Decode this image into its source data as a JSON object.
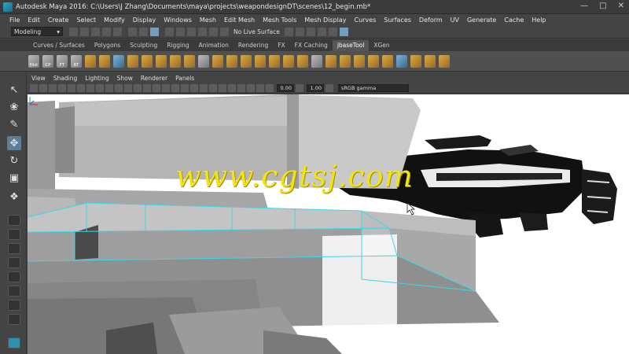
{
  "window": {
    "title": "Autodesk Maya 2016: C:\\Users\\J Zhang\\Documents\\maya\\projects\\weapondesignDT\\scenes\\12_begin.mb*",
    "controls": [
      "—",
      "□",
      "✕"
    ]
  },
  "menubar": [
    "File",
    "Edit",
    "Create",
    "Select",
    "Modify",
    "Display",
    "Windows",
    "Mesh",
    "Edit Mesh",
    "Mesh Tools",
    "Mesh Display",
    "Curves",
    "Surfaces",
    "Deform",
    "UV",
    "Generate",
    "Cache",
    "Help"
  ],
  "statusline": {
    "mode": "Modeling",
    "live_surface": "No Live Surface"
  },
  "shelf": {
    "tabs": [
      "Curves / Surfaces",
      "Polygons",
      "Sculpting",
      "Rigging",
      "Animation",
      "Rendering",
      "FX",
      "FX Caching",
      "jbaseTool",
      "XGen"
    ],
    "active_tab": "jbaseTool",
    "labeled_icons": [
      "Hist",
      "CP",
      "FT",
      "RT"
    ]
  },
  "panel": {
    "menus": [
      "View",
      "Shading",
      "Lighting",
      "Show",
      "Renderer",
      "Panels"
    ],
    "exposure": "0.00",
    "gamma_value": "1.00",
    "color_space": "sRGB gamma"
  },
  "viewport": {
    "watermark": "www.cgtsj.com"
  },
  "colors": {
    "watermark": "#f2e21a",
    "selection_wire": "#3fd6e6",
    "active_tab": "#555555",
    "selected_tool": "#5d7e99"
  }
}
